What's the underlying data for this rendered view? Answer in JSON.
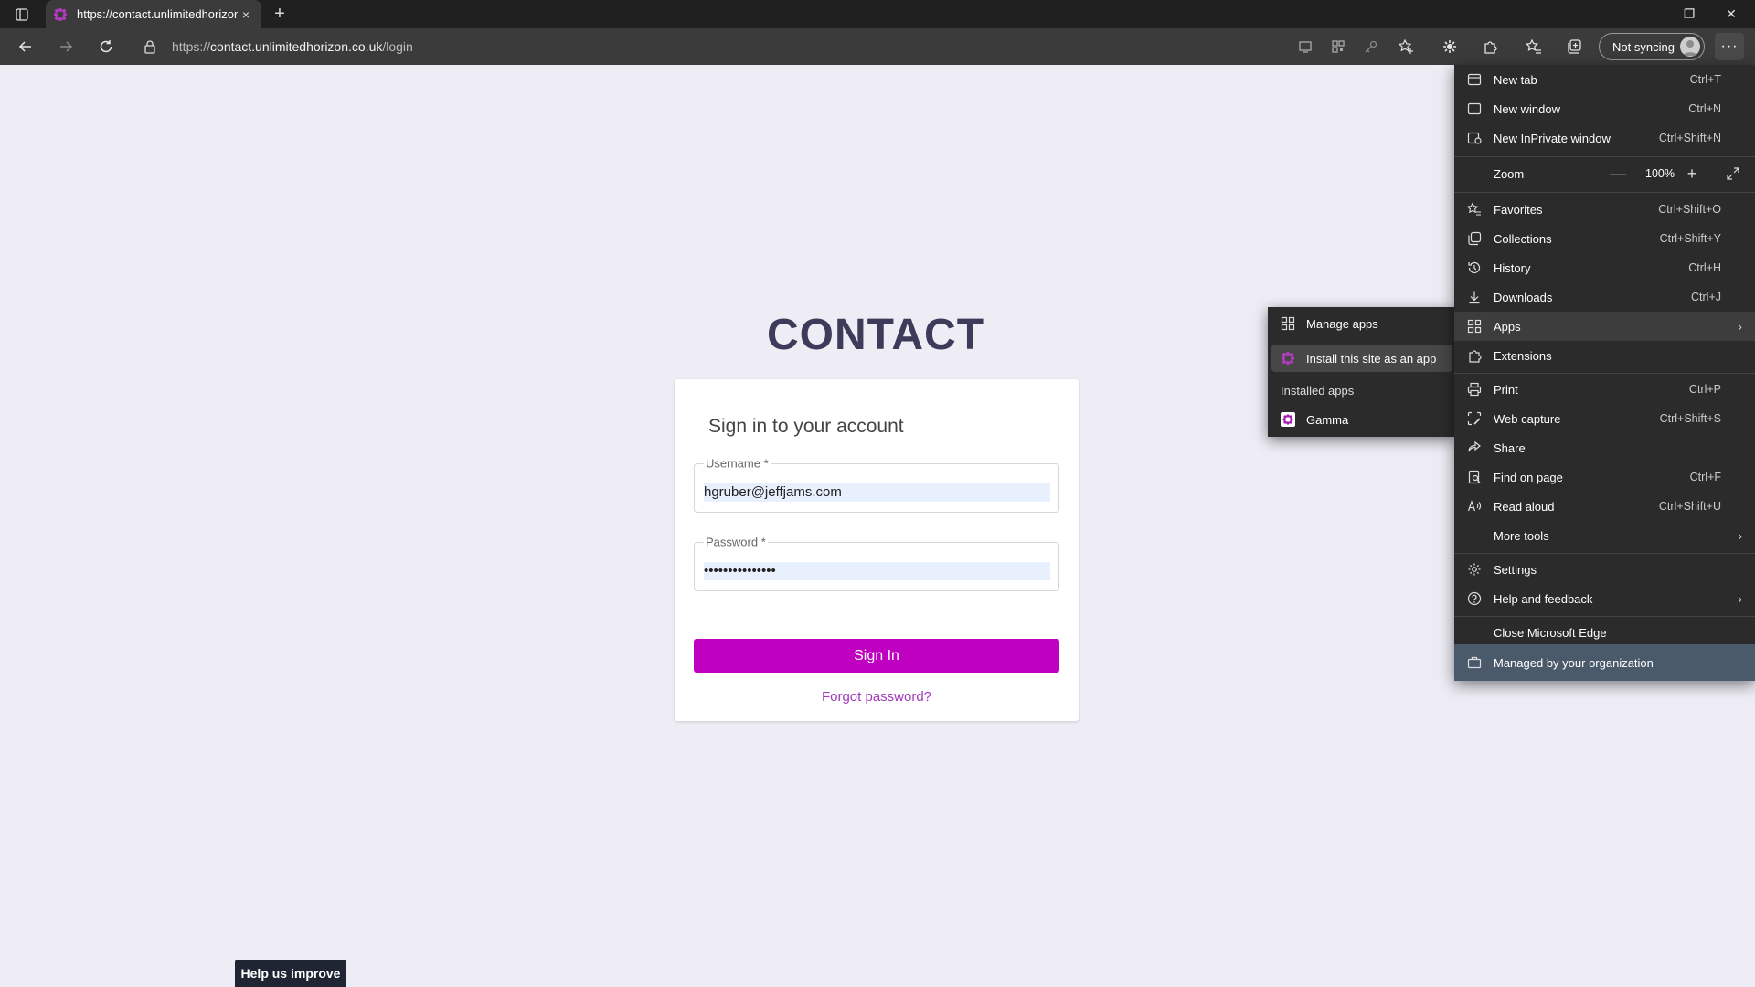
{
  "browser": {
    "tab_title": "https://contact.unlimitedhorizon",
    "tab_close": "×",
    "new_tab": "+",
    "url_scheme": "https://",
    "url_host": "contact.unlimitedhorizon.co.uk",
    "url_path": "/login",
    "sync_label": "Not syncing",
    "window_minimize": "—",
    "window_restore": "❐",
    "window_close": "✕"
  },
  "page": {
    "brand": "CONTACT",
    "card_title": "Sign in to your account",
    "username_label": "Username  *",
    "username_value": "hgruber@jeffjams.com",
    "password_label": "Password  *",
    "password_value": "•••••••••••••••",
    "signin_label": "Sign In",
    "forgot_label": "Forgot password?",
    "help_label": "Help us improve"
  },
  "menu": {
    "items": [
      {
        "label": "New tab",
        "shortcut": "Ctrl+T",
        "icon": "new-tab-icon"
      },
      {
        "label": "New window",
        "shortcut": "Ctrl+N",
        "icon": "new-window-icon"
      },
      {
        "label": "New InPrivate window",
        "shortcut": "Ctrl+Shift+N",
        "icon": "inprivate-icon"
      },
      {
        "label": "Zoom",
        "value": "100%",
        "minus": "—",
        "plus": "+"
      },
      {
        "label": "Favorites",
        "shortcut": "Ctrl+Shift+O",
        "icon": "favorites-icon"
      },
      {
        "label": "Collections",
        "shortcut": "Ctrl+Shift+Y",
        "icon": "collections-icon"
      },
      {
        "label": "History",
        "shortcut": "Ctrl+H",
        "icon": "history-icon"
      },
      {
        "label": "Downloads",
        "shortcut": "Ctrl+J",
        "icon": "downloads-icon"
      },
      {
        "label": "Apps",
        "icon": "apps-icon"
      },
      {
        "label": "Extensions",
        "icon": "extensions-icon"
      },
      {
        "label": "Print",
        "shortcut": "Ctrl+P",
        "icon": "print-icon"
      },
      {
        "label": "Web capture",
        "shortcut": "Ctrl+Shift+S",
        "icon": "web-capture-icon"
      },
      {
        "label": "Share",
        "icon": "share-icon"
      },
      {
        "label": "Find on page",
        "shortcut": "Ctrl+F",
        "icon": "find-icon"
      },
      {
        "label": "Read aloud",
        "shortcut": "Ctrl+Shift+U",
        "icon": "read-aloud-icon"
      },
      {
        "label": "More tools"
      },
      {
        "label": "Settings",
        "icon": "settings-icon"
      },
      {
        "label": "Help and feedback",
        "icon": "help-icon"
      },
      {
        "label": "Close Microsoft Edge"
      },
      {
        "label": "Managed by your organization",
        "icon": "briefcase-icon"
      }
    ]
  },
  "submenu": {
    "manage_apps": "Manage apps",
    "install_site": "Install this site as an app",
    "installed_header": "Installed apps",
    "gamma": "Gamma"
  },
  "colors": {
    "accent": "#c000c0",
    "page_bg": "#eeedf5",
    "brand": "#3d3b5a",
    "menu_bg": "#2b2b2b",
    "managed_bg": "#4b5a6b"
  }
}
